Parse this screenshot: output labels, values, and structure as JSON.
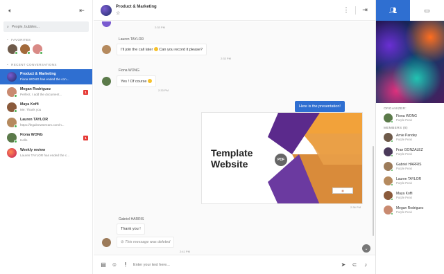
{
  "sidebar": {
    "search_placeholder": "People, bubbles...",
    "favorites_label": "FAVORITES",
    "recent_label": "RECENT CONVERSATIONS",
    "conversations": [
      {
        "name": "Product & Marketing",
        "preview": "Fiona WONG has ended the con...",
        "active": true
      },
      {
        "name": "Megan Rodriguez",
        "preview": "Perfect, I add the document...",
        "badge": "1"
      },
      {
        "name": "Maya Koffi",
        "preview": "Me: Thank you"
      },
      {
        "name": "Lauren TAYLOR",
        "preview": "https://legalnewstream.com/n..."
      },
      {
        "name": "Fiona WONG",
        "preview": "Hello",
        "badge": "1"
      },
      {
        "name": "Weekly review",
        "preview": "Lauren TAYLOR has ended the c..."
      }
    ]
  },
  "header": {
    "title": "Product & Marketing",
    "star": "☆"
  },
  "messages": {
    "time_top": "2:33 PM",
    "lauren_name": "Lauren TAYLOR",
    "lauren_text_a": "I'll join the call later",
    "lauren_text_b": "Can you record it please?",
    "lauren_time": "2:33 PM",
    "fiona_name": "Fiona WONG",
    "fiona_text": "Yes ! Of course",
    "fiona_time": "2:33 PM",
    "my_text": "Here is the presentation!",
    "preview_title": "Template Website",
    "preview_badge": "PDF",
    "preview_time": "2:36 PM",
    "gabriel_name": "Gabriel HARRIS",
    "gabriel_text": "Thank you !",
    "deleted_text": "This message was deleted",
    "deleted_time": "2:41 PM"
  },
  "composer": {
    "placeholder": "Enter your text here..."
  },
  "right_panel": {
    "organizer_label": "ORGANIZER:",
    "organizer": {
      "name": "Fiona WONG",
      "role": "Purple Peak"
    },
    "members_label": "MEMBERS (8)",
    "members": [
      {
        "name": "Arnie Pandey",
        "role": "Purple Peak"
      },
      {
        "name": "Fran GONZALEZ",
        "role": "Purple Peak"
      },
      {
        "name": "Gabriel HARRIS",
        "role": "Purple Peak"
      },
      {
        "name": "Lauren TAYLOR",
        "role": "Purple Peak"
      },
      {
        "name": "Maya Koffi",
        "role": "Purple Peak"
      },
      {
        "name": "Megan Rodriguez",
        "role": "Purple Peak"
      }
    ]
  },
  "colors": {
    "accent": "#2f6fd1",
    "badge": "#e53935",
    "online": "#4caf50"
  }
}
